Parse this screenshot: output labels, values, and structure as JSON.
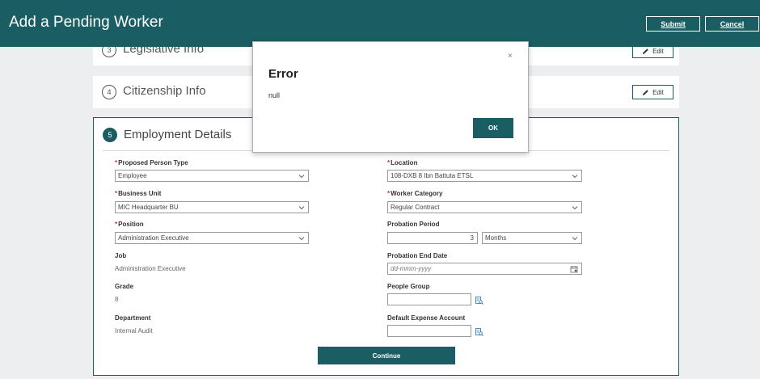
{
  "header": {
    "title": "Add a Pending Worker",
    "submit_label": "Submit",
    "cancel_label": "Cancel"
  },
  "sections": {
    "legislative": {
      "step": "3",
      "title": "Legislative Info",
      "edit_label": "Edit"
    },
    "citizenship": {
      "step": "4",
      "title": "Citizenship Info",
      "edit_label": "Edit"
    },
    "employment": {
      "step": "5",
      "title": "Employment Details",
      "fields": {
        "proposed_person_type": {
          "label": "Proposed Person Type",
          "value": "Employee"
        },
        "location": {
          "label": "Location",
          "value": "108-DXB 8 Ibn Battuta ETSL"
        },
        "business_unit": {
          "label": "Business Unit",
          "value": "MIC Headquarter BU"
        },
        "worker_category": {
          "label": "Worker Category",
          "value": "Regular Contract"
        },
        "position": {
          "label": "Position",
          "value": "Administration Executive"
        },
        "probation_period": {
          "label": "Probation Period",
          "value": "3",
          "unit": "Months"
        },
        "job": {
          "label": "Job",
          "value": "Administration Executive"
        },
        "probation_end_date": {
          "label": "Probation End Date",
          "placeholder": "dd-mmm-yyyy"
        },
        "grade": {
          "label": "Grade",
          "value": "8"
        },
        "people_group": {
          "label": "People Group",
          "value": ""
        },
        "department": {
          "label": "Department",
          "value": "Internal Audit"
        },
        "default_expense_account": {
          "label": "Default Expense Account",
          "value": ""
        }
      },
      "required_marker": "*",
      "continue_label": "Continue"
    }
  },
  "dialog": {
    "title": "Error",
    "message": "null",
    "ok_label": "OK",
    "close_glyph": "×"
  },
  "colors": {
    "brand": "#1a5d63",
    "background": "#eceef0",
    "required": "#c0392b"
  },
  "icons": {
    "edit": "pencil-icon",
    "dropdown": "chevron-down-icon",
    "calendar": "calendar-icon",
    "lookup": "search-list-icon",
    "close": "close-icon"
  }
}
